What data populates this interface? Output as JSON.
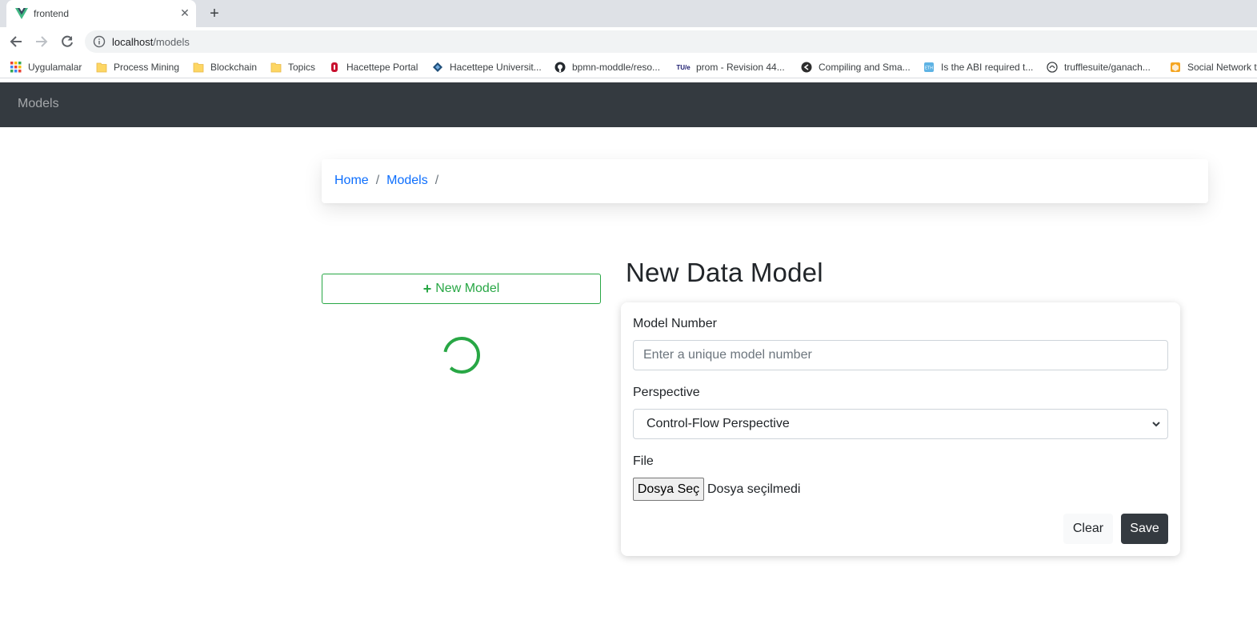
{
  "browser": {
    "tab_title": "frontend",
    "tab_favicon": "vue-logo-icon",
    "url_host": "localhost",
    "url_path": "/models",
    "bookmarks": [
      {
        "label": "Uygulamalar",
        "icon": "apps-grid-icon"
      },
      {
        "label": "Process Mining",
        "icon": "folder-icon"
      },
      {
        "label": "Blockchain",
        "icon": "folder-icon"
      },
      {
        "label": "Topics",
        "icon": "folder-icon"
      },
      {
        "label": "Hacettepe Portal",
        "icon": "hacettepe-icon"
      },
      {
        "label": "Hacettepe Universit...",
        "icon": "hacettepe-univ-icon"
      },
      {
        "label": "bpmn-moddle/reso...",
        "icon": "github-icon"
      },
      {
        "label": "prom - Revision 44...",
        "icon": "tue-icon"
      },
      {
        "label": "Compiling and Sma...",
        "icon": "compiling-icon"
      },
      {
        "label": "Is the ABI required t...",
        "icon": "eth-icon"
      },
      {
        "label": "trufflesuite/ganach...",
        "icon": "truffle-icon"
      },
      {
        "label": "Social Network t",
        "icon": "social-network-icon"
      }
    ]
  },
  "navbar": {
    "brand": "Models"
  },
  "breadcrumb": {
    "items": [
      "Home",
      "Models"
    ],
    "separator": "/"
  },
  "sidebar": {
    "new_model_label": "New Model",
    "loading": true
  },
  "form": {
    "title": "New Data Model",
    "model_number_label": "Model Number",
    "model_number_value": "",
    "model_number_placeholder": "Enter a unique model number",
    "perspective_label": "Perspective",
    "perspective_selected": "Control-Flow Perspective",
    "file_label": "File",
    "file_button": "Dosya Seç",
    "file_status": "Dosya seçilmedi",
    "clear_label": "Clear",
    "save_label": "Save"
  },
  "colors": {
    "navbar_bg": "#343a40",
    "link": "#0d6efd",
    "success": "#28a745",
    "save_bg": "#343a40"
  }
}
